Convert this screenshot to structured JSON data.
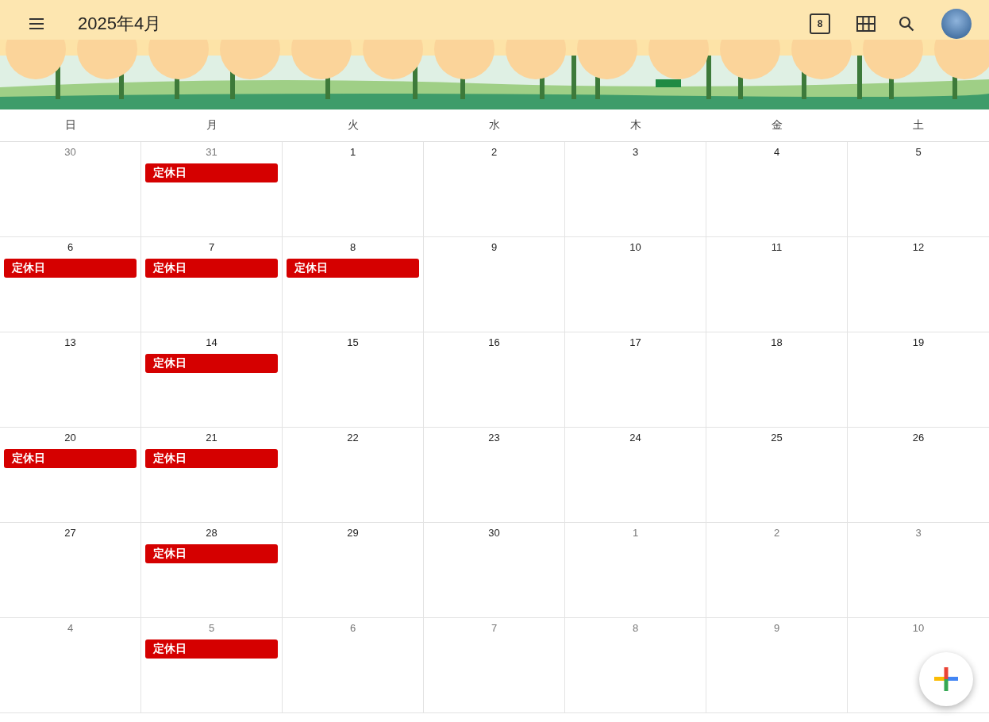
{
  "header": {
    "title": "2025年4月",
    "today_badge": "8"
  },
  "weekdays": [
    "日",
    "月",
    "火",
    "水",
    "木",
    "金",
    "土"
  ],
  "weeks": [
    [
      {
        "day": "30",
        "in_month": false
      },
      {
        "day": "31",
        "in_month": false,
        "events": [
          "定休日"
        ]
      },
      {
        "day": "1",
        "in_month": true
      },
      {
        "day": "2",
        "in_month": true
      },
      {
        "day": "3",
        "in_month": true
      },
      {
        "day": "4",
        "in_month": true
      },
      {
        "day": "5",
        "in_month": true
      }
    ],
    [
      {
        "day": "6",
        "in_month": true,
        "events": [
          "定休日"
        ]
      },
      {
        "day": "7",
        "in_month": true,
        "events": [
          "定休日"
        ]
      },
      {
        "day": "8",
        "in_month": true,
        "events": [
          "定休日"
        ]
      },
      {
        "day": "9",
        "in_month": true
      },
      {
        "day": "10",
        "in_month": true
      },
      {
        "day": "11",
        "in_month": true
      },
      {
        "day": "12",
        "in_month": true
      }
    ],
    [
      {
        "day": "13",
        "in_month": true
      },
      {
        "day": "14",
        "in_month": true,
        "events": [
          "定休日"
        ]
      },
      {
        "day": "15",
        "in_month": true
      },
      {
        "day": "16",
        "in_month": true
      },
      {
        "day": "17",
        "in_month": true
      },
      {
        "day": "18",
        "in_month": true
      },
      {
        "day": "19",
        "in_month": true
      }
    ],
    [
      {
        "day": "20",
        "in_month": true,
        "events": [
          "定休日"
        ]
      },
      {
        "day": "21",
        "in_month": true,
        "events": [
          "定休日"
        ]
      },
      {
        "day": "22",
        "in_month": true
      },
      {
        "day": "23",
        "in_month": true
      },
      {
        "day": "24",
        "in_month": true
      },
      {
        "day": "25",
        "in_month": true
      },
      {
        "day": "26",
        "in_month": true
      }
    ],
    [
      {
        "day": "27",
        "in_month": true
      },
      {
        "day": "28",
        "in_month": true,
        "events": [
          "定休日"
        ]
      },
      {
        "day": "29",
        "in_month": true
      },
      {
        "day": "30",
        "in_month": true
      },
      {
        "day": "1",
        "in_month": false
      },
      {
        "day": "2",
        "in_month": false
      },
      {
        "day": "3",
        "in_month": false
      }
    ],
    [
      {
        "day": "4",
        "in_month": false
      },
      {
        "day": "5",
        "in_month": false,
        "events": [
          "定休日"
        ]
      },
      {
        "day": "6",
        "in_month": false
      },
      {
        "day": "7",
        "in_month": false
      },
      {
        "day": "8",
        "in_month": false
      },
      {
        "day": "9",
        "in_month": false
      },
      {
        "day": "10",
        "in_month": false
      }
    ]
  ]
}
